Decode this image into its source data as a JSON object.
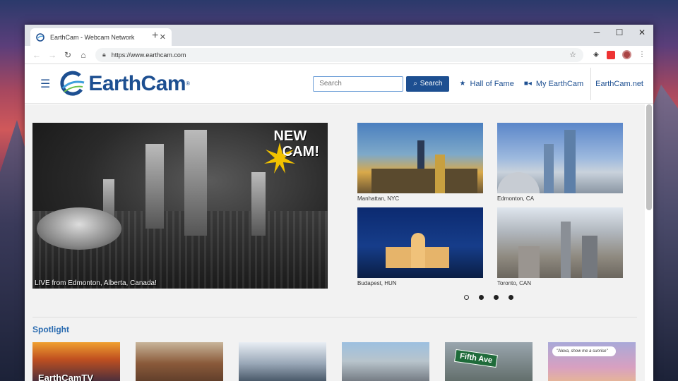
{
  "browser": {
    "tab_title": "EarthCam - Webcam Network",
    "tab_close": "✕",
    "new_tab": "+",
    "url": "https://www.earthcam.com",
    "window_controls": [
      "─",
      "☐",
      "✕"
    ]
  },
  "site": {
    "logo_text": "EarthCam",
    "logo_mark": "®",
    "search_placeholder": "Search",
    "search_button": "Search",
    "nav": [
      {
        "label": "Hall of Fame",
        "icon": "star-icon"
      },
      {
        "label": "My EarthCam",
        "icon": "video-camera-icon"
      },
      {
        "label": "EarthCam.net",
        "icon": ""
      }
    ]
  },
  "hero": {
    "badge_line1": "NEW",
    "badge_line2": "CAM!",
    "caption": "LIVE from Edmonton, Alberta, Canada!"
  },
  "featured": [
    {
      "label": "Manhattan, NYC"
    },
    {
      "label": "Edmonton, CA"
    },
    {
      "label": "Budapest, HUN"
    },
    {
      "label": "Toronto, CAN"
    }
  ],
  "carousel": {
    "count": 4,
    "active_index": 0
  },
  "spotlight": {
    "title": "Spotlight",
    "items": [
      {
        "label": "EarthCamTV"
      },
      {
        "label": ""
      },
      {
        "label": ""
      },
      {
        "label": ""
      },
      {
        "label": "Fifth Ave"
      },
      {
        "label": "\"Alexa, show me a sunrise\""
      }
    ]
  },
  "colors": {
    "brand": "#1d4f91",
    "link": "#2a6bb0"
  }
}
